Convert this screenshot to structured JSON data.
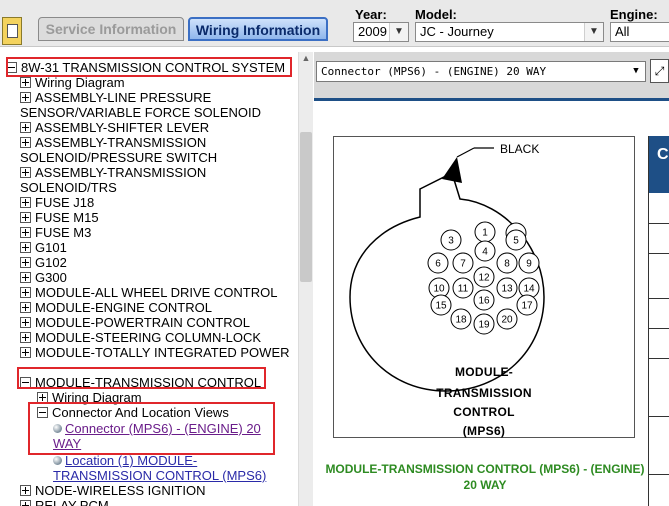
{
  "topbar": {
    "tabs": [
      {
        "label": "Service Information"
      },
      {
        "label": "Wiring Information"
      }
    ],
    "year": {
      "label": "Year:",
      "value": "2009"
    },
    "model": {
      "label": "Model:",
      "value": "JC - Journey"
    },
    "engine": {
      "label": "Engine:",
      "value": "All"
    }
  },
  "tree": {
    "root": "8W-31 TRANSMISSION CONTROL SYSTEM",
    "items": [
      "Wiring Diagram",
      "ASSEMBLY-LINE PRESSURE SENSOR/VARIABLE FORCE SOLENOID",
      "ASSEMBLY-SHIFTER LEVER",
      "ASSEMBLY-TRANSMISSION SOLENOID/PRESSURE SWITCH",
      "ASSEMBLY-TRANSMISSION SOLENOID/TRS",
      "FUSE J18",
      "FUSE M15",
      "FUSE M3",
      "G101",
      "G102",
      "G300",
      "MODULE-ALL WHEEL DRIVE CONTROL",
      "MODULE-ENGINE CONTROL",
      "MODULE-POWERTRAIN CONTROL",
      "MODULE-STEERING COLUMN-LOCK",
      "MODULE-TOTALLY INTEGRATED POWER",
      "MODULE-TRANSMISSION CONTROL",
      "Wiring Diagram",
      "Connector And Location Views",
      "Connector (MPS6) - (ENGINE) 20 WAY",
      "Location (1) MODULE-TRANSMISSION CONTROL (MPS6)",
      "NODE-WIRELESS IGNITION",
      "RELAY-PCM"
    ]
  },
  "right": {
    "connector_select": "Connector (MPS6) - (ENGINE) 20 WAY",
    "diagram": {
      "callout": "BLACK",
      "pins": [
        "1",
        "2",
        "3",
        "4",
        "5",
        "6",
        "7",
        "8",
        "9",
        "10",
        "11",
        "12",
        "13",
        "14",
        "15",
        "16",
        "17",
        "18",
        "19",
        "20"
      ],
      "module_lines": [
        "MODULE-",
        "TRANSMISSION",
        "CONTROL",
        "(MPS6)"
      ]
    },
    "caption": "MODULE-TRANSMISSION CONTROL (MPS6) - (ENGINE) 20 WAY",
    "side_table_head": "C"
  },
  "colors": {
    "accent_blue": "#1e4f86",
    "highlight_red": "#e0262b",
    "caption_green": "#2e8b22",
    "link_purple": "#6a1d8a"
  }
}
